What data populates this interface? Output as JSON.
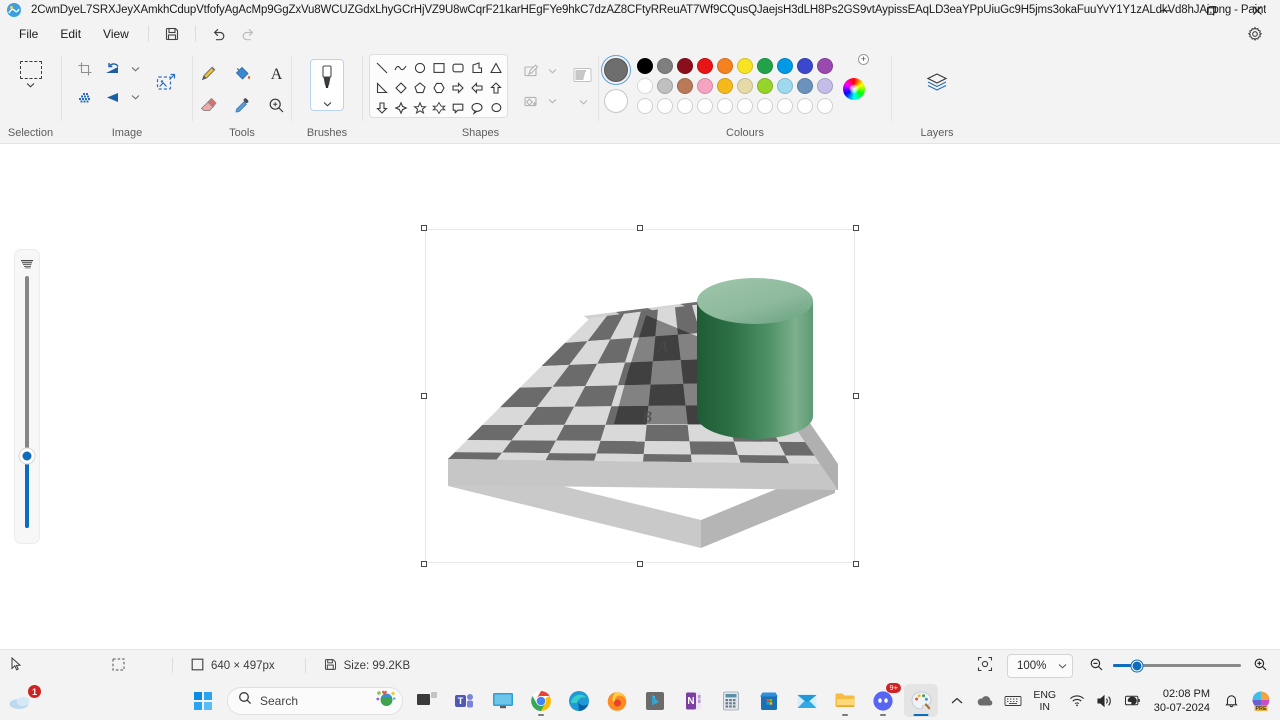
{
  "window": {
    "title": "2CwnDyeL7SRXJeyXAmkhCdupVtfofyAgAcMp9GgZxVu8WCUZGdxLhyGCrHjVZ9U8wCqrF21karHEgFYe9hkC7dzAZ8CFtyRReuAT7Wf9CQusQJaejsH3dLH8Ps2GS9vtAypissEAqLD3eaYPpUiuGc9H5jms3okaFuuYvY1Y1zALdkVd8hJAi.png - Paint",
    "app_icon": "paint-app-icon",
    "minimize": "─",
    "maximize": "❐",
    "close": "✕"
  },
  "menubar": {
    "items": [
      {
        "label": "File"
      },
      {
        "label": "Edit"
      },
      {
        "label": "View"
      }
    ],
    "save_icon": "save-icon",
    "undo_icon": "undo-icon",
    "redo_icon": "redo-icon",
    "settings_icon": "gear-icon"
  },
  "ribbon": {
    "groups": [
      {
        "name": "selection",
        "label": "Selection"
      },
      {
        "name": "image",
        "label": "Image"
      },
      {
        "name": "tools",
        "label": "Tools"
      },
      {
        "name": "brushes",
        "label": "Brushes"
      },
      {
        "name": "shapes",
        "label": "Shapes"
      },
      {
        "name": "colours",
        "label": "Colours"
      },
      {
        "name": "layers",
        "label": "Layers"
      }
    ],
    "selection": {
      "label": "Selection",
      "rectangular_select": "rectangular-selection-icon",
      "dropdown": "chevron-down-icon"
    },
    "image": {
      "label": "Image",
      "crop": "crop-icon",
      "resize": "resize-skew-icon",
      "rotate": "rotate-icon",
      "flip": "flip-icon",
      "resize_image": "resize-image-icon"
    },
    "tools": {
      "label": "Tools",
      "items": [
        {
          "name": "pencil-icon"
        },
        {
          "name": "fill-bucket-icon"
        },
        {
          "name": "text-icon"
        },
        {
          "name": "eraser-icon"
        },
        {
          "name": "eyedropper-icon"
        },
        {
          "name": "magnifier-icon"
        }
      ]
    },
    "brushes": {
      "label": "Brushes",
      "current": "marker-brush-icon",
      "dropdown": "chevron-down-icon"
    },
    "shapes": {
      "label": "Shapes",
      "items": [
        "line-shape",
        "curve-shape",
        "oval-shape",
        "rectangle-shape",
        "rounded-rectangle-shape",
        "polygon-shape",
        "triangle-shape",
        "right-triangle-shape",
        "diamond-shape",
        "pentagon-shape",
        "hexagon-shape",
        "arrow-right-shape",
        "arrow-left-shape",
        "arrow-up-shape",
        "arrow-down-shape",
        "four-point-star-shape",
        "five-point-star-shape",
        "six-point-star-shape",
        "rounded-callout-shape",
        "oval-callout-shape",
        "cloud-callout-shape",
        "heart-shape",
        "lightning-shape"
      ],
      "outline_button": "shape-outline-icon",
      "fill_button": "shape-fill-icon",
      "thickness_button": "shape-thickness-icon",
      "dropdown": "chevron-down-icon"
    },
    "colours": {
      "label": "Colours",
      "primary_color": "#6e6e6e",
      "secondary_color": "#ffffff",
      "selected": "primary",
      "row1": [
        "#000000",
        "#7f7f7f",
        "#8b0f1b",
        "#e81416",
        "#f58220",
        "#f7e424",
        "#22a34a",
        "#0099e5",
        "#3c48cc",
        "#9a49ae"
      ],
      "row2": [
        "#ffffff",
        "#c0c0c0",
        "#b97a57",
        "#f5a3c0",
        "#f5b91c",
        "#e5dba8",
        "#96d42a",
        "#9fd9ef",
        "#6b92bd",
        "#c3bde8"
      ],
      "row3": [
        "",
        "",
        "",
        "",
        "",
        "",
        "",
        "",
        "",
        ""
      ],
      "color_picker": "color-wheel-icon",
      "add_color": "+"
    },
    "layers": {
      "label": "Layers",
      "icon": "layers-icon"
    }
  },
  "canvas": {
    "brush_size_slider": {
      "icon": "brush-size-icon",
      "value": 30
    },
    "image": {
      "alt": "checker-shadow-illusion",
      "labels": [
        "A",
        "B"
      ],
      "cylinder_color": "#3f8055",
      "cylinder_top_color": "#8bbd9a",
      "board_light": "#d9d9d9",
      "board_dark": "#6b6b6b",
      "shadow_light": "#a9a9a9",
      "shadow_dark": "#4c4c4c"
    }
  },
  "statusbar": {
    "cursor_icon": "cursor-arrow-icon",
    "selection_icon": "selection-size-icon",
    "canvas_size_icon": "canvas-size-icon",
    "canvas_size": "640 × 497px",
    "file_size_icon": "save-floppy-icon",
    "file_size": "Size: 99.2KB",
    "fit_icon": "fit-to-window-icon",
    "zoom_value": "100%",
    "zoom_dropdown": "chevron-down-icon",
    "zoom_out_icon": "zoom-out-icon",
    "zoom_in_icon": "zoom-in-icon",
    "zoom_percent": 100
  },
  "taskbar": {
    "weather": {
      "icon": "weather-cloud-icon",
      "badge": "1"
    },
    "start": "windows-start-icon",
    "search": {
      "icon": "search-icon",
      "placeholder": "Search",
      "trailing_icon": "earth-emoji-icon"
    },
    "apps": [
      {
        "name": "task-view-icon",
        "running": false
      },
      {
        "name": "microsoft-teams-icon",
        "running": false
      },
      {
        "name": "remote-desktop-icon",
        "running": false
      },
      {
        "name": "google-chrome-icon",
        "running": true
      },
      {
        "name": "microsoft-edge-icon",
        "running": false
      },
      {
        "name": "mozilla-firefox-icon",
        "running": false
      },
      {
        "name": "bing-copilot-icon",
        "running": false
      },
      {
        "name": "microsoft-onenote-icon",
        "running": false
      },
      {
        "name": "calculator-icon",
        "running": false
      },
      {
        "name": "microsoft-store-icon",
        "running": false
      },
      {
        "name": "mail-icon",
        "running": false
      },
      {
        "name": "file-explorer-icon",
        "running": true
      },
      {
        "name": "discord-icon",
        "running": true,
        "badge": "9+"
      },
      {
        "name": "paint-icon",
        "running": true,
        "active": true
      }
    ],
    "tray": {
      "chevron": "show-hidden-icons-chevron",
      "onedrive": "onedrive-icon",
      "keyboard": "touch-keyboard-icon",
      "language_top": "ENG",
      "language_bottom": "IN",
      "wifi": "wifi-icon",
      "volume": "volume-icon",
      "battery": "battery-icon",
      "time": "02:08 PM",
      "date": "30-07-2024",
      "notifications": "notification-bell-icon",
      "copilot": "copilot-pre-icon"
    }
  }
}
